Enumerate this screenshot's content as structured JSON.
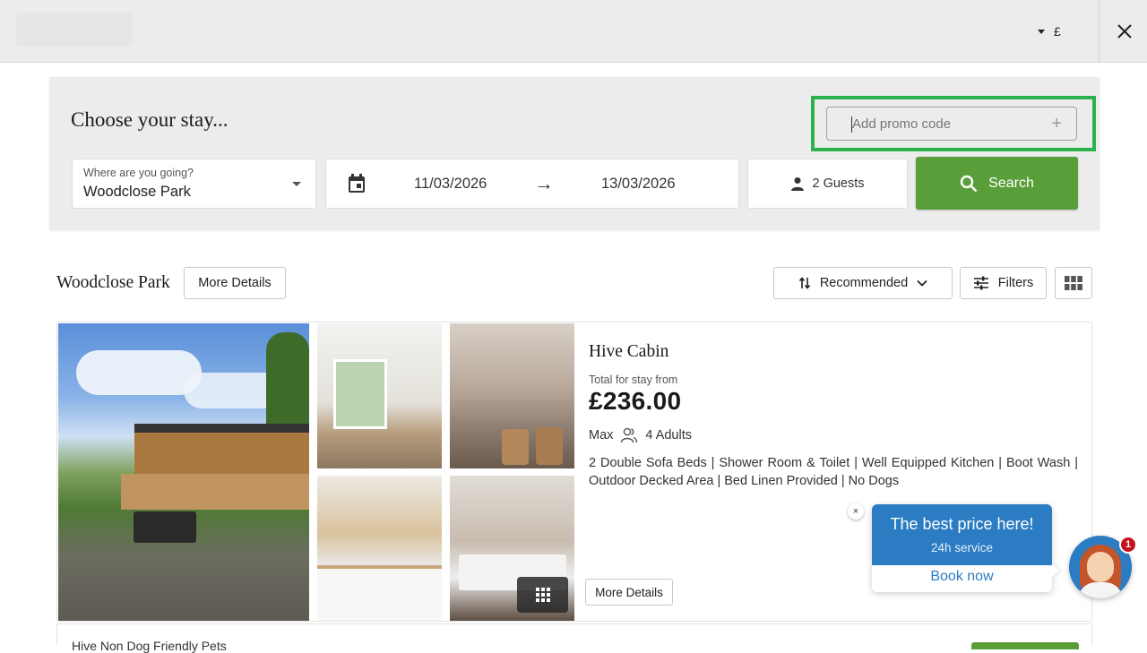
{
  "header": {
    "currency_symbol": "£"
  },
  "search_panel": {
    "title": "Choose your stay...",
    "promo_placeholder": "Add promo code",
    "promo_add_symbol": "+",
    "where": {
      "label": "Where are you going?",
      "value": "Woodclose Park"
    },
    "dates": {
      "check_in": "11/03/2026",
      "arrow": "→",
      "check_out": "13/03/2026"
    },
    "guests_label": "2 Guests",
    "search_label": "Search",
    "colors": {
      "search_button": "#5a9e3a",
      "promo_highlight": "#2bb24c"
    }
  },
  "park": {
    "name": "Woodclose Park",
    "more_details_label": "More Details",
    "sort_label": "Recommended",
    "filters_label": "Filters"
  },
  "card": {
    "unit_name": "Hive Cabin",
    "total_label": "Total for stay from",
    "price": "£236.00",
    "max_label": "Max",
    "capacity": "4 Adults",
    "features": "2 Double Sofa Beds | Shower Room & Toilet | Well Equipped Kitchen | Boot Wash | Outdoor Decked Area | Bed Linen Provided | No Dogs",
    "more_details_label": "More Details"
  },
  "next_card": {
    "title": "Hive Non Dog Friendly Pets"
  },
  "chat_widget": {
    "headline": "The best price here!",
    "subline": "24h service",
    "cta": "Book now",
    "close_symbol": "×",
    "badge_count": "1",
    "colors": {
      "primary": "#2b7cc3",
      "badge": "#c4121c"
    }
  }
}
